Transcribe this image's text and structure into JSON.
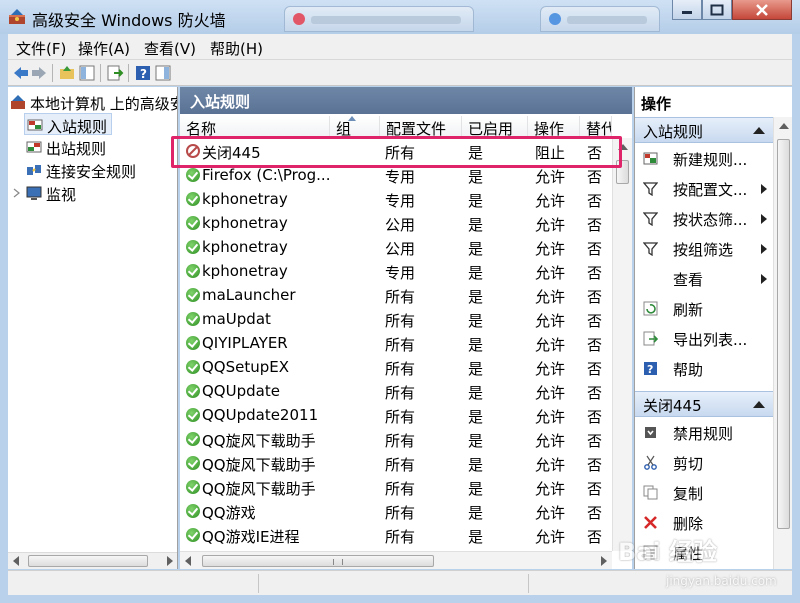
{
  "window": {
    "title": "高级安全 Windows 防火墙"
  },
  "menu": [
    {
      "label": "文件(F)"
    },
    {
      "label": "操作(A)"
    },
    {
      "label": "查看(V)"
    },
    {
      "label": "帮助(H)"
    }
  ],
  "tree": {
    "root": "本地计算机 上的高级安全",
    "items": [
      {
        "label": "入站规则",
        "selected": true
      },
      {
        "label": "出站规则"
      },
      {
        "label": "连接安全规则"
      },
      {
        "label": "监视"
      }
    ]
  },
  "center": {
    "title": "入站规则",
    "columns": [
      "名称",
      "组",
      "配置文件",
      "已启用",
      "操作",
      "替代"
    ],
    "rows": [
      {
        "name": "关闭445",
        "profile": "所有",
        "enabled": "是",
        "action": "阻止",
        "override": "否",
        "type": "block"
      },
      {
        "name": "Firefox (C:\\Prog...",
        "profile": "专用",
        "enabled": "是",
        "action": "允许",
        "override": "否",
        "type": "allow"
      },
      {
        "name": "kphonetray",
        "profile": "专用",
        "enabled": "是",
        "action": "允许",
        "override": "否",
        "type": "allow"
      },
      {
        "name": "kphonetray",
        "profile": "公用",
        "enabled": "是",
        "action": "允许",
        "override": "否",
        "type": "allow"
      },
      {
        "name": "kphonetray",
        "profile": "公用",
        "enabled": "是",
        "action": "允许",
        "override": "否",
        "type": "allow"
      },
      {
        "name": "kphonetray",
        "profile": "专用",
        "enabled": "是",
        "action": "允许",
        "override": "否",
        "type": "allow"
      },
      {
        "name": "maLauncher",
        "profile": "所有",
        "enabled": "是",
        "action": "允许",
        "override": "否",
        "type": "allow"
      },
      {
        "name": "maUpdat",
        "profile": "所有",
        "enabled": "是",
        "action": "允许",
        "override": "否",
        "type": "allow"
      },
      {
        "name": "QIYIPLAYER",
        "profile": "所有",
        "enabled": "是",
        "action": "允许",
        "override": "否",
        "type": "allow"
      },
      {
        "name": "QQSetupEX",
        "profile": "所有",
        "enabled": "是",
        "action": "允许",
        "override": "否",
        "type": "allow"
      },
      {
        "name": "QQUpdate",
        "profile": "所有",
        "enabled": "是",
        "action": "允许",
        "override": "否",
        "type": "allow"
      },
      {
        "name": "QQUpdate2011",
        "profile": "所有",
        "enabled": "是",
        "action": "允许",
        "override": "否",
        "type": "allow"
      },
      {
        "name": "QQ旋风下载助手",
        "profile": "所有",
        "enabled": "是",
        "action": "允许",
        "override": "否",
        "type": "allow"
      },
      {
        "name": "QQ旋风下载助手",
        "profile": "所有",
        "enabled": "是",
        "action": "允许",
        "override": "否",
        "type": "allow"
      },
      {
        "name": "QQ旋风下载助手",
        "profile": "所有",
        "enabled": "是",
        "action": "允许",
        "override": "否",
        "type": "allow"
      },
      {
        "name": "QQ游戏",
        "profile": "所有",
        "enabled": "是",
        "action": "允许",
        "override": "否",
        "type": "allow"
      },
      {
        "name": "QQ游戏IE进程",
        "profile": "所有",
        "enabled": "是",
        "action": "允许",
        "override": "否",
        "type": "allow"
      }
    ]
  },
  "actions": {
    "title": "操作",
    "section1": "入站规则",
    "section1_items": [
      {
        "label": "新建规则...",
        "icon": "new-rule-icon",
        "submenu": false
      },
      {
        "label": "按配置文...",
        "icon": "filter-icon",
        "submenu": true
      },
      {
        "label": "按状态筛...",
        "icon": "filter-icon",
        "submenu": true
      },
      {
        "label": "按组筛选",
        "icon": "filter-icon",
        "submenu": true
      },
      {
        "label": "查看",
        "icon": "",
        "submenu": true
      },
      {
        "label": "刷新",
        "icon": "refresh-icon",
        "submenu": false
      },
      {
        "label": "导出列表...",
        "icon": "export-icon",
        "submenu": false
      },
      {
        "label": "帮助",
        "icon": "help-icon",
        "submenu": false
      }
    ],
    "section2": "关闭445",
    "section2_items": [
      {
        "label": "禁用规则",
        "icon": "disable-icon"
      },
      {
        "label": "剪切",
        "icon": "cut-icon"
      },
      {
        "label": "复制",
        "icon": "copy-icon"
      },
      {
        "label": "删除",
        "icon": "delete-icon"
      },
      {
        "label": "属性",
        "icon": "properties-icon"
      }
    ]
  },
  "watermark": {
    "main": "Bai 经验",
    "sub": "jingyan.baidu.com"
  },
  "colors": {
    "highlight": "#e0246a",
    "pane_header": "#5a7294",
    "section": "#c8d9ef"
  }
}
